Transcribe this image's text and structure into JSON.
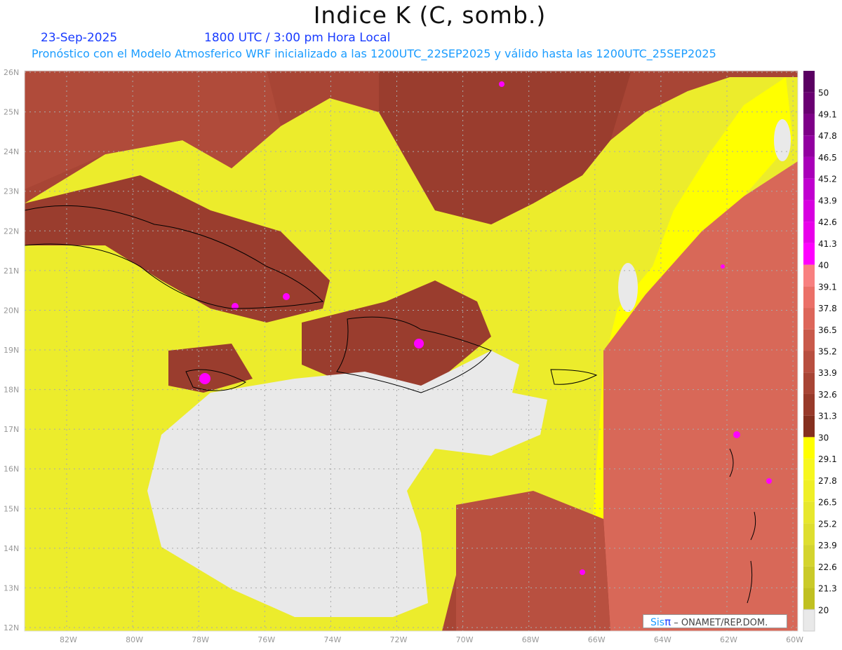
{
  "title": "Indice K (C, somb.)",
  "date": "23-Sep-2025",
  "time": "1800 UTC / 3:00 pm Hora Local",
  "model_info": "Pronóstico con el Modelo Atmosferico WRF inicializado a las 1200UTC_22SEP2025 y válido hasta las  1200UTC_25SEP2025",
  "credit": {
    "sis": "Sis",
    "pi": "π",
    "rest": "– ONAMET/REP.DOM."
  },
  "lat_labels": [
    "12N",
    "13N",
    "14N",
    "15N",
    "16N",
    "17N",
    "18N",
    "19N",
    "20N",
    "21N",
    "22N",
    "23N",
    "24N",
    "25N",
    "26N"
  ],
  "lon_labels": [
    "82W",
    "80W",
    "78W",
    "76W",
    "74W",
    "72W",
    "70W",
    "68W",
    "66W",
    "64W",
    "62W",
    "60W"
  ],
  "colorbar": {
    "labels": [
      "50",
      "49.1",
      "47.8",
      "46.5",
      "45.2",
      "43.9",
      "42.6",
      "41.3",
      "40",
      "39.1",
      "37.8",
      "36.5",
      "35.2",
      "33.9",
      "32.6",
      "31.3",
      "30",
      "29.1",
      "27.8",
      "26.5",
      "25.2",
      "23.9",
      "22.6",
      "21.3",
      "20"
    ],
    "colors": [
      "#5a0062",
      "#6a0072",
      "#7e0088",
      "#9200a0",
      "#a900b9",
      "#c000cf",
      "#d700e0",
      "#e800ea",
      "#ff00ff",
      "#f88080",
      "#eb7068",
      "#dd665a",
      "#c95a4b",
      "#b84f40",
      "#a84535",
      "#983a2a",
      "#85301f",
      "#ffff00",
      "#f7f71f",
      "#efef27",
      "#e7e72d",
      "#dede2f",
      "#d4d42e",
      "#caca29",
      "#c0c021",
      "#e9e9e9"
    ]
  }
}
